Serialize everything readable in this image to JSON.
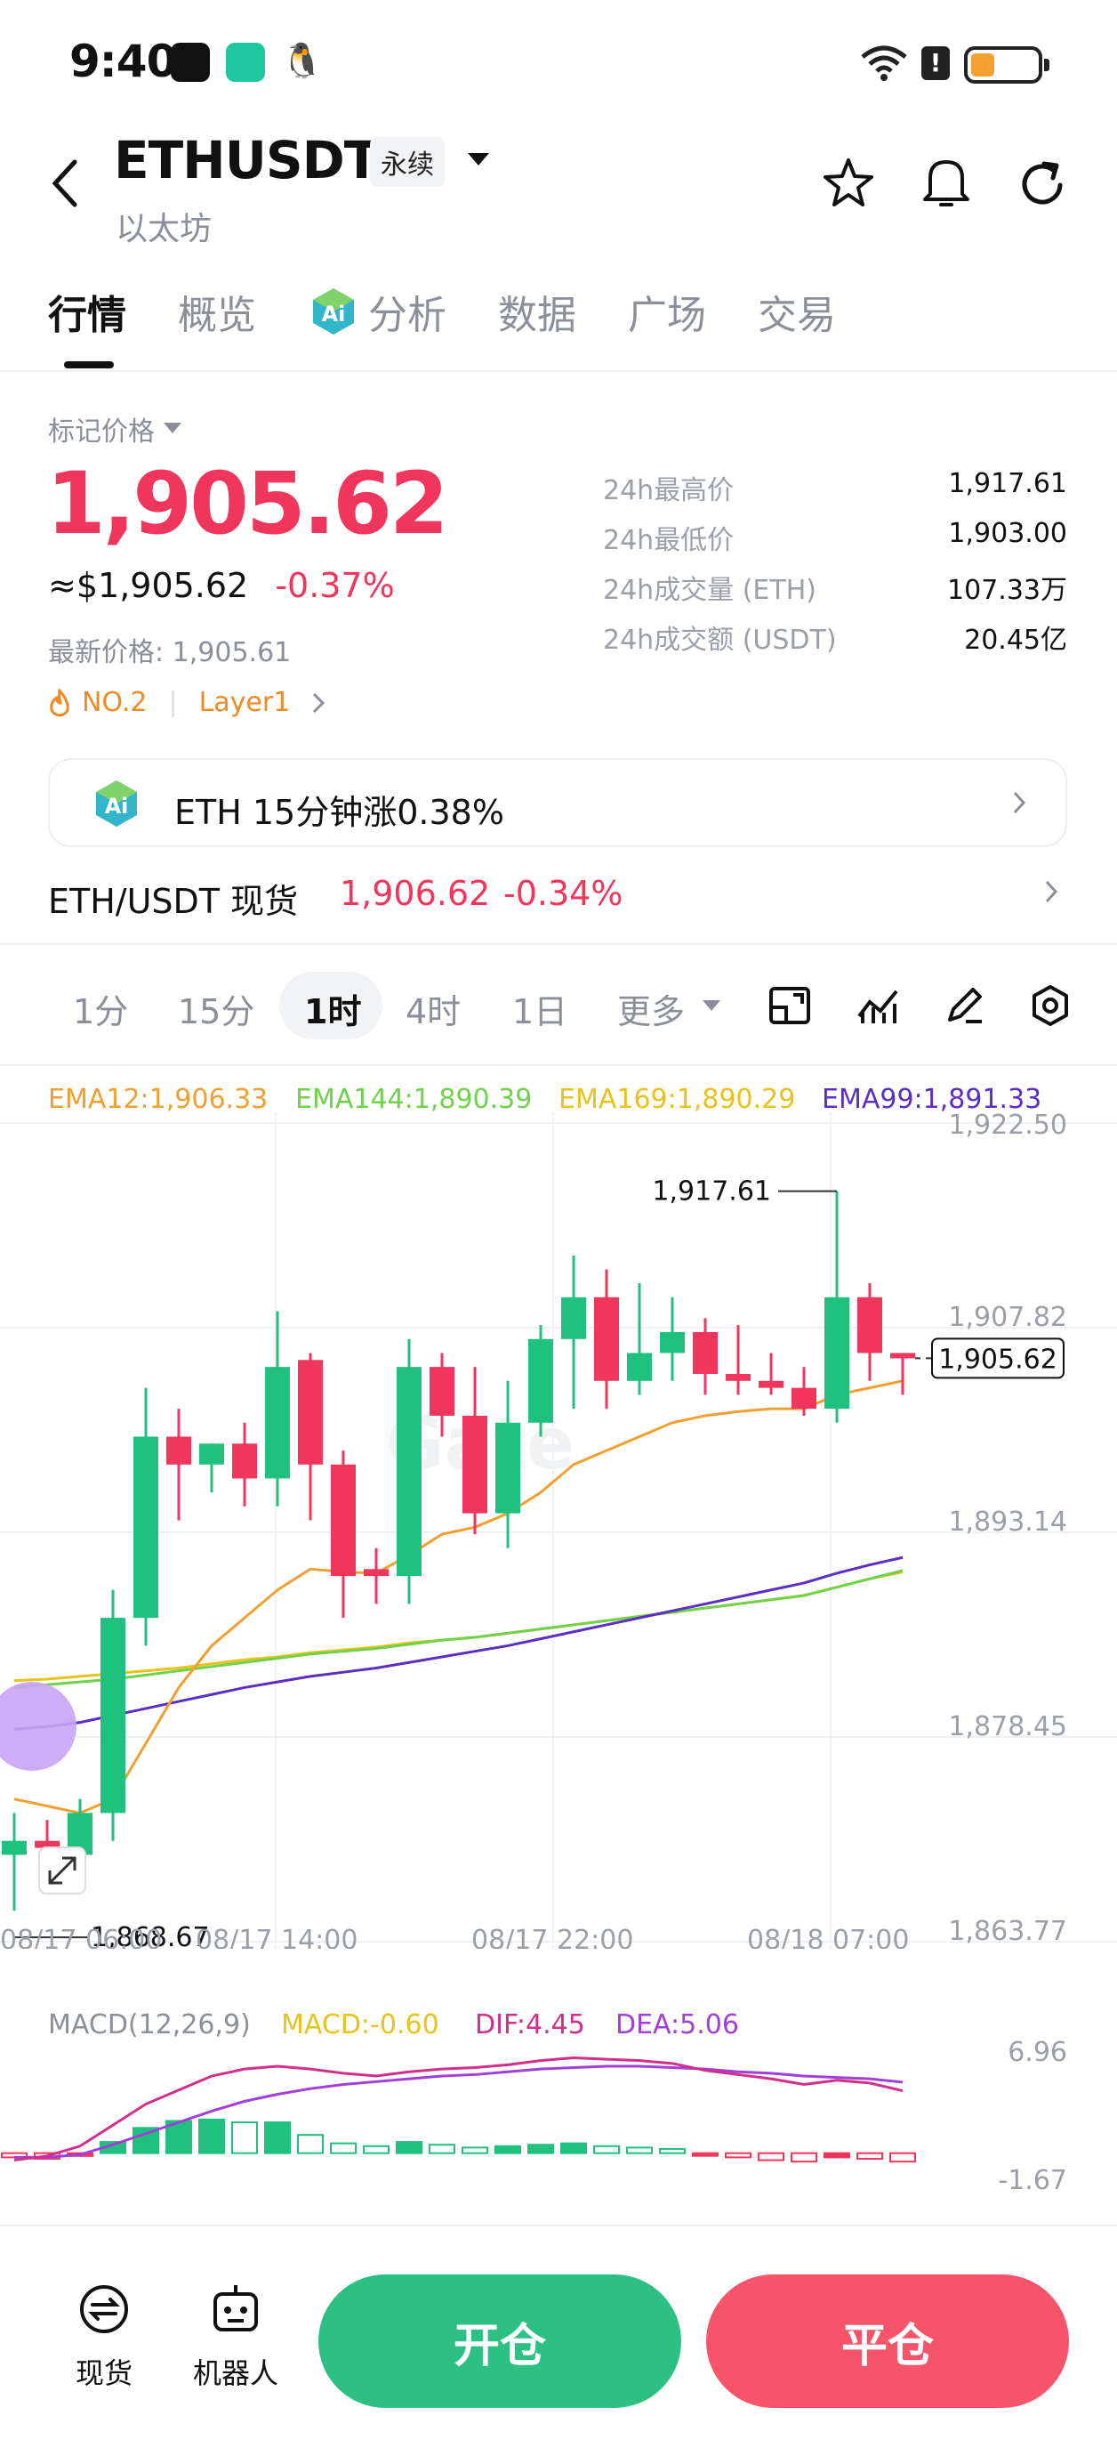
{
  "status": {
    "time": "9:40"
  },
  "header": {
    "symbol": "ETHUSDT",
    "contract_tag": "永续",
    "subtitle": "以太坊"
  },
  "tabs": [
    "行情",
    "概览",
    "分析",
    "数据",
    "广场",
    "交易"
  ],
  "price_block": {
    "mark_label": "标记价格",
    "mark_price": "1,905.62",
    "usd_price": "≈$1,905.62",
    "change": "-0.37%",
    "latest": "最新价格: 1,905.61",
    "rank": "NO.2",
    "category": "Layer1"
  },
  "stats": [
    {
      "label": "24h最高价",
      "value": "1,917.61"
    },
    {
      "label": "24h最低价",
      "value": "1,903.00"
    },
    {
      "label": "24h成交量 (ETH)",
      "value": "107.33万"
    },
    {
      "label": "24h成交额 (USDT)",
      "value": "20.45亿"
    }
  ],
  "ai_banner": {
    "text": "ETH 15分钟涨0.38%"
  },
  "spot_row": {
    "label": "ETH/USDT 现货",
    "price": "1,906.62",
    "change": "-0.34%"
  },
  "periods": [
    "1分",
    "15分",
    "1时",
    "4时",
    "1日",
    "更多"
  ],
  "ema_legend": [
    {
      "text": "EMA12:1,906.33",
      "color": "#f0a030"
    },
    {
      "text": "EMA144:1,890.39",
      "color": "#6fd24a"
    },
    {
      "text": "EMA169:1,890.29",
      "color": "#e8c31b"
    },
    {
      "text": "EMA99:1,891.33",
      "color": "#5a2fc2"
    }
  ],
  "price_axis": [
    "1,922.50",
    "1,907.82",
    "1,893.14",
    "1,878.45",
    "1,863.77"
  ],
  "time_axis": [
    "08/17 06:00",
    "08/17 14:00",
    "08/17 22:00",
    "08/18 07:00"
  ],
  "annotations": {
    "high": "1,917.61",
    "low": "1,868.67",
    "current": "1,905.62"
  },
  "macd_legend": {
    "title": "MACD(12,26,9)",
    "macd": "MACD:-0.60",
    "dif": "DIF:4.45",
    "dea": "DEA:5.06",
    "axis_top": "6.96",
    "axis_bottom": "-1.67"
  },
  "bottom": {
    "spot_label": "现货",
    "bot_label": "机器人",
    "open_label": "开仓",
    "close_label": "平仓"
  },
  "colors": {
    "up": "#20c07e",
    "down": "#f0365d",
    "open_btn": "#2cc183",
    "close_btn": "#f5546a"
  },
  "chart_data": {
    "type": "candlestick",
    "x_labels": [
      "08/17 06:00",
      "08/17 14:00",
      "08/17 22:00",
      "08/18 07:00"
    ],
    "ylim": [
      1863.77,
      1922.5
    ],
    "candles": [
      {
        "o": 1870.0,
        "h": 1873.0,
        "l": 1866.0,
        "c": 1871.0
      },
      {
        "o": 1871.0,
        "h": 1872.5,
        "l": 1868.0,
        "c": 1870.5
      },
      {
        "o": 1870.0,
        "h": 1874.0,
        "l": 1869.0,
        "c": 1873.0
      },
      {
        "o": 1873.0,
        "h": 1889.0,
        "l": 1871.0,
        "c": 1887.0
      },
      {
        "o": 1887.0,
        "h": 1903.5,
        "l": 1885.0,
        "c": 1900.0
      },
      {
        "o": 1900.0,
        "h": 1902.0,
        "l": 1894.0,
        "c": 1898.0
      },
      {
        "o": 1898.0,
        "h": 1899.5,
        "l": 1896.0,
        "c": 1899.5
      },
      {
        "o": 1899.5,
        "h": 1901.0,
        "l": 1895.0,
        "c": 1897.0
      },
      {
        "o": 1897.0,
        "h": 1909.0,
        "l": 1895.0,
        "c": 1905.0
      },
      {
        "o": 1905.5,
        "h": 1906.0,
        "l": 1894.0,
        "c": 1898.0
      },
      {
        "o": 1898.0,
        "h": 1899.0,
        "l": 1887.0,
        "c": 1890.0
      },
      {
        "o": 1890.5,
        "h": 1892.0,
        "l": 1888.0,
        "c": 1890.0
      },
      {
        "o": 1890.0,
        "h": 1907.0,
        "l": 1888.0,
        "c": 1905.0
      },
      {
        "o": 1905.0,
        "h": 1906.0,
        "l": 1900.0,
        "c": 1901.5
      },
      {
        "o": 1901.5,
        "h": 1905.0,
        "l": 1893.0,
        "c": 1894.5
      },
      {
        "o": 1894.5,
        "h": 1904.0,
        "l": 1892.0,
        "c": 1901.0
      },
      {
        "o": 1901.0,
        "h": 1908.0,
        "l": 1900.0,
        "c": 1907.0
      },
      {
        "o": 1907.0,
        "h": 1913.0,
        "l": 1902.0,
        "c": 1910.0
      },
      {
        "o": 1910.0,
        "h": 1912.0,
        "l": 1902.0,
        "c": 1904.0
      },
      {
        "o": 1904.0,
        "h": 1911.0,
        "l": 1903.0,
        "c": 1906.0
      },
      {
        "o": 1906.0,
        "h": 1910.0,
        "l": 1904.0,
        "c": 1907.5
      },
      {
        "o": 1907.5,
        "h": 1908.5,
        "l": 1903.0,
        "c": 1904.5
      },
      {
        "o": 1904.5,
        "h": 1908.0,
        "l": 1903.0,
        "c": 1904.0
      },
      {
        "o": 1904.0,
        "h": 1906.0,
        "l": 1903.0,
        "c": 1903.5
      },
      {
        "o": 1903.5,
        "h": 1905.0,
        "l": 1901.5,
        "c": 1902.0
      },
      {
        "o": 1902.0,
        "h": 1917.61,
        "l": 1901.0,
        "c": 1910.0
      },
      {
        "o": 1910.0,
        "h": 1911.0,
        "l": 1904.0,
        "c": 1906.0
      },
      {
        "o": 1906.0,
        "h": 1906.0,
        "l": 1903.0,
        "c": 1905.62
      }
    ],
    "ema12": [
      1874.0,
      1873.5,
      1873.0,
      1874.0,
      1878.0,
      1882.0,
      1885.0,
      1887.0,
      1889.0,
      1890.5,
      1890.3,
      1890.2,
      1891.5,
      1893.0,
      1893.5,
      1894.5,
      1896.0,
      1898.0,
      1899.0,
      1900.0,
      1901.0,
      1901.5,
      1901.8,
      1902.0,
      1902.0,
      1903.0,
      1903.5,
      1904.0
    ],
    "ema144": [
      1882.0,
      1882.2,
      1882.4,
      1882.6,
      1882.9,
      1883.2,
      1883.5,
      1883.8,
      1884.1,
      1884.4,
      1884.6,
      1884.8,
      1885.1,
      1885.4,
      1885.6,
      1885.9,
      1886.2,
      1886.5,
      1886.8,
      1887.1,
      1887.4,
      1887.7,
      1888.0,
      1888.3,
      1888.6,
      1889.2,
      1889.8,
      1890.39
    ],
    "ema169": [
      1882.5,
      1882.6,
      1882.8,
      1883.0,
      1883.2,
      1883.4,
      1883.7,
      1884.0,
      1884.2,
      1884.5,
      1884.7,
      1884.9,
      1885.2,
      1885.4,
      1885.6,
      1885.9,
      1886.2,
      1886.5,
      1886.8,
      1887.1,
      1887.4,
      1887.7,
      1888.0,
      1888.3,
      1888.6,
      1889.2,
      1889.8,
      1890.29
    ],
    "ema99": [
      1879.0,
      1879.2,
      1879.5,
      1880.0,
      1880.5,
      1881.0,
      1881.5,
      1882.0,
      1882.4,
      1882.8,
      1883.1,
      1883.4,
      1883.8,
      1884.2,
      1884.6,
      1885.0,
      1885.5,
      1886.0,
      1886.5,
      1887.0,
      1887.5,
      1888.0,
      1888.5,
      1889.0,
      1889.5,
      1890.2,
      1890.8,
      1891.33
    ],
    "macd_hist": [
      -0.3,
      -0.4,
      -0.2,
      0.8,
      1.8,
      2.3,
      2.4,
      2.2,
      2.2,
      1.3,
      0.7,
      0.5,
      0.8,
      0.6,
      0.4,
      0.5,
      0.6,
      0.7,
      0.5,
      0.4,
      0.3,
      -0.1,
      -0.3,
      -0.5,
      -0.6,
      -0.3,
      -0.4,
      -0.6
    ],
    "dif": [
      -0.5,
      -0.2,
      0.5,
      2.0,
      3.5,
      4.5,
      5.5,
      6.0,
      6.2,
      6.0,
      5.7,
      5.5,
      5.8,
      6.0,
      6.1,
      6.3,
      6.6,
      6.8,
      6.7,
      6.6,
      6.4,
      5.9,
      5.6,
      5.3,
      4.9,
      5.2,
      5.0,
      4.45
    ],
    "dea": [
      -0.3,
      -0.3,
      -0.1,
      0.6,
      1.4,
      2.2,
      3.0,
      3.7,
      4.2,
      4.6,
      4.9,
      5.1,
      5.3,
      5.5,
      5.6,
      5.8,
      6.0,
      6.1,
      6.2,
      6.2,
      6.1,
      6.0,
      5.8,
      5.7,
      5.5,
      5.4,
      5.3,
      5.06
    ],
    "macd_ylim": [
      -1.67,
      6.96
    ]
  }
}
